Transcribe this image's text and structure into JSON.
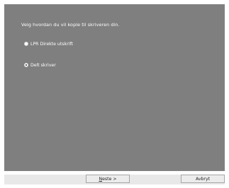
{
  "dialog": {
    "instruction": "Velg hvordan du vil kople til skriveren din."
  },
  "options": [
    {
      "label": "LPR Direkte utskrift",
      "selected": false
    },
    {
      "label": "Delt skriver",
      "selected": true
    }
  ],
  "buttons": {
    "next_label": "Neste >",
    "cancel_label": "Avbryt"
  }
}
